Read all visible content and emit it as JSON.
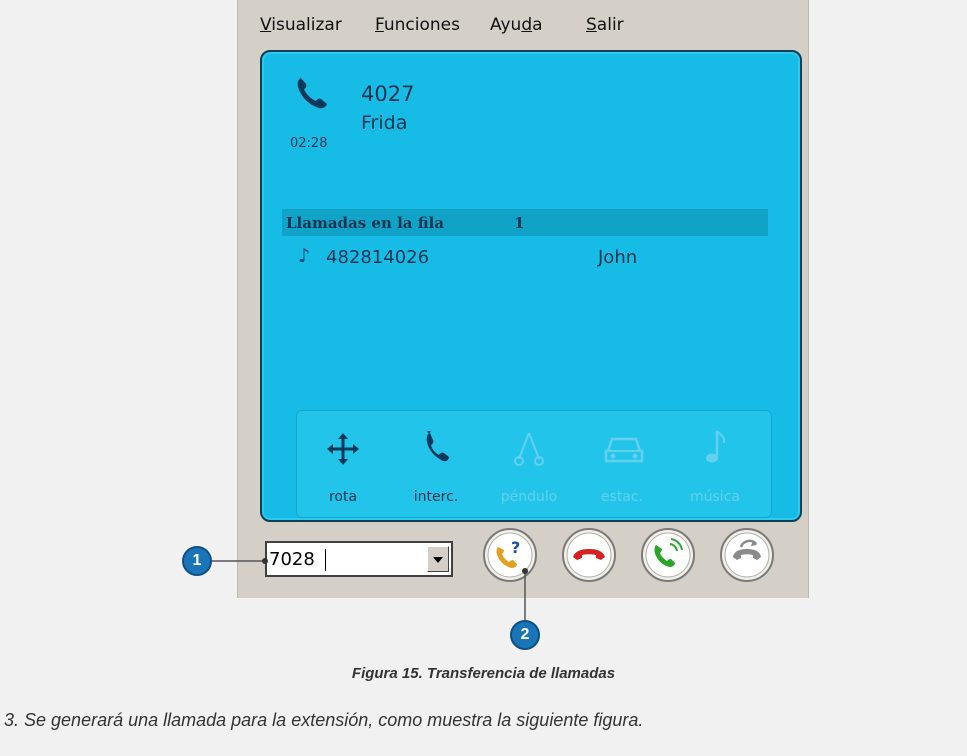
{
  "menu": {
    "items": [
      {
        "pre": "",
        "ul": "V",
        "post": "isualizar"
      },
      {
        "pre": "",
        "ul": "F",
        "post": "unciones"
      },
      {
        "pre": "Ayu",
        "ul": "d",
        "post": "a"
      },
      {
        "pre": "",
        "ul": "S",
        "post": "alir"
      }
    ]
  },
  "active_call": {
    "number": "4027",
    "name": "Frida",
    "duration": "02:28",
    "icon": "phone-handset-icon"
  },
  "queue": {
    "title": "Llamadas en la fila",
    "count": "1",
    "items": [
      {
        "number": "482814026",
        "name": "John",
        "icon": "music-note-icon"
      }
    ]
  },
  "actions": [
    {
      "label": "rota",
      "icon": "move-arrows-icon",
      "enabled": true
    },
    {
      "label": "interc.",
      "icon": "handset-swap-icon",
      "enabled": true
    },
    {
      "label": "péndulo",
      "icon": "pendulum-icon",
      "enabled": false
    },
    {
      "label": "estac.",
      "icon": "car-icon",
      "enabled": false
    },
    {
      "label": "música",
      "icon": "music-note-icon",
      "enabled": false
    }
  ],
  "dial": {
    "value": "7028"
  },
  "buttons": [
    {
      "name": "consult-transfer-button",
      "icon": "phone-question-icon",
      "color": "#e3a021"
    },
    {
      "name": "hangup-button",
      "icon": "phone-hangup-icon",
      "color": "#d82020"
    },
    {
      "name": "answer-button",
      "icon": "phone-ring-icon",
      "color": "#2aa52a"
    },
    {
      "name": "forward-button",
      "icon": "phone-forward-icon",
      "color": "#8a8a8a"
    }
  ],
  "callouts": [
    "1",
    "2"
  ],
  "caption": "Figura 15. Transferencia de llamadas",
  "paragraph": "3.   Se generará una llamada para la extensión, como muestra la siguiente figura."
}
